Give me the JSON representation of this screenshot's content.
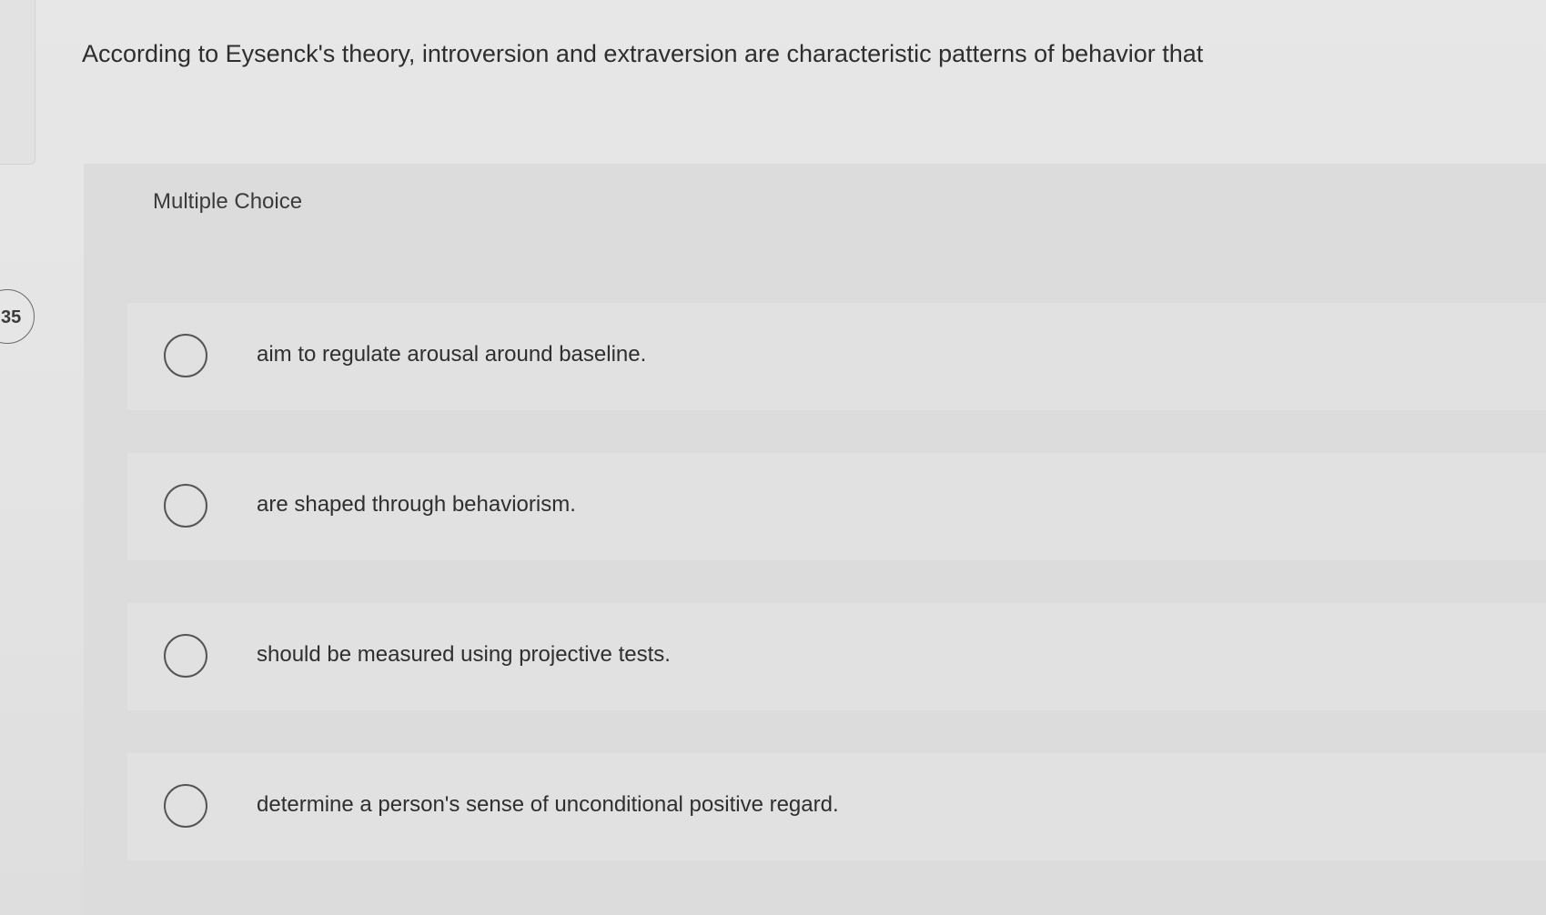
{
  "question": {
    "number": "35",
    "text": "According to Eysenck's theory, introversion and extraversion are characteristic patterns of behavior that"
  },
  "panel": {
    "label": "Multiple Choice"
  },
  "options": [
    {
      "label": "aim to regulate arousal around baseline."
    },
    {
      "label": "are shaped through behaviorism."
    },
    {
      "label": "should be measured using projective tests."
    },
    {
      "label": "determine a person's sense of unconditional positive regard."
    }
  ]
}
